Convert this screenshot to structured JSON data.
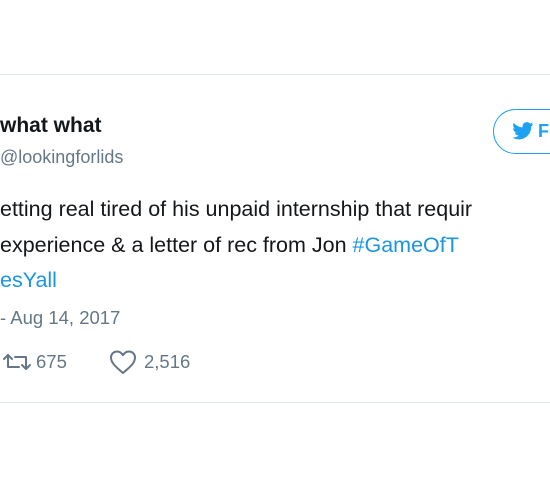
{
  "tweet": {
    "display_name": "what what",
    "handle": "@lookingforlids",
    "follow_label": "F",
    "text": {
      "line1": "etting real tired of his unpaid internship that requir",
      "line2_text": " experience & a letter of rec from Jon ",
      "line2_hashtag": "#GameOfT",
      "line3_hashtag": "esYall"
    },
    "timestamp": "- Aug 14, 2017",
    "retweets": "675",
    "likes": "2,516"
  },
  "icons": {
    "follow": "twitter-bird-icon",
    "retweet": "retweet-icon",
    "like": "heart-icon"
  },
  "colors": {
    "accent": "#1da1f2",
    "hashtag": "#1b95e0",
    "text": "#14171a",
    "secondary": "#657786",
    "border": "#e1e8ed"
  }
}
